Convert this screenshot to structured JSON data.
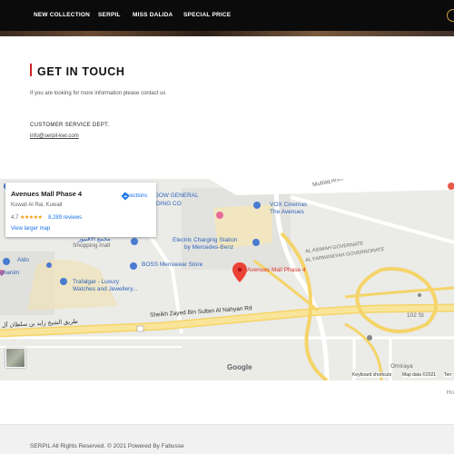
{
  "nav": {
    "items": [
      {
        "label": "NEW COLLECTION"
      },
      {
        "label": "SERPIL"
      },
      {
        "label": "MISS DALIDA"
      },
      {
        "label": "SPECIAL PRICE"
      }
    ],
    "colors": {
      "background": "#0b0b0b",
      "text": "#ffffff",
      "accent": "#cc2222"
    }
  },
  "contact": {
    "title": "GET IN TOUCH",
    "intro": "If you are looking for more information please contact us",
    "dept_label": "CUSTOMER SERVICE DEPT.",
    "email": "info@serpil-kwi.com"
  },
  "map": {
    "card": {
      "place": "Avenues Mall Phase 4",
      "address": "Kuwait Al Rai, Kuwait",
      "rating": "4.7",
      "stars": "★★★★★",
      "reviews": "8,289 reviews",
      "larger_map": "View larger map",
      "directions": "Directions"
    },
    "labels": {
      "mutlaq": "Mutlaq Ahm",
      "woodw": "DOW GENERAL",
      "trading": "DING CO",
      "vox1": "VOX Cinemas",
      "vox2": "The Avenues",
      "charging1": "Electric Charging Station",
      "charging2": "by Mercedes-Benz",
      "shopping": "Shopping mall",
      "arabic_mall": "مجمع الافنيوز",
      "aldo": "Aldo",
      "boss": "BOSS Menswear Store",
      "ghanim": "ghanim",
      "trafalgar1": "Trafalgar - Luxury",
      "trafalgar2": "Watches and Jewellery...",
      "asimah1": "AL ASIMAH GOVERNATE",
      "asimah2": "AL FARWANIYAH GOVERNORATE",
      "marker": "Avenues Mall Phase 4",
      "road": "Sheikh Zayed Bin Sultan Al Nahyan Rd",
      "arabic_road": "طريق الشيخ زايد بن سلطان آل",
      "st102": "102 St",
      "omiraya": "Omiraya",
      "google": "Google",
      "shortcuts": "Keyboard shortcuts",
      "mapdata": "Map data ©2021",
      "terms": "Terr"
    }
  },
  "hint": "Ho",
  "footer": {
    "copyright": "SERPIL All Rights Reserved. © 2021 Powered By Fabusse"
  }
}
